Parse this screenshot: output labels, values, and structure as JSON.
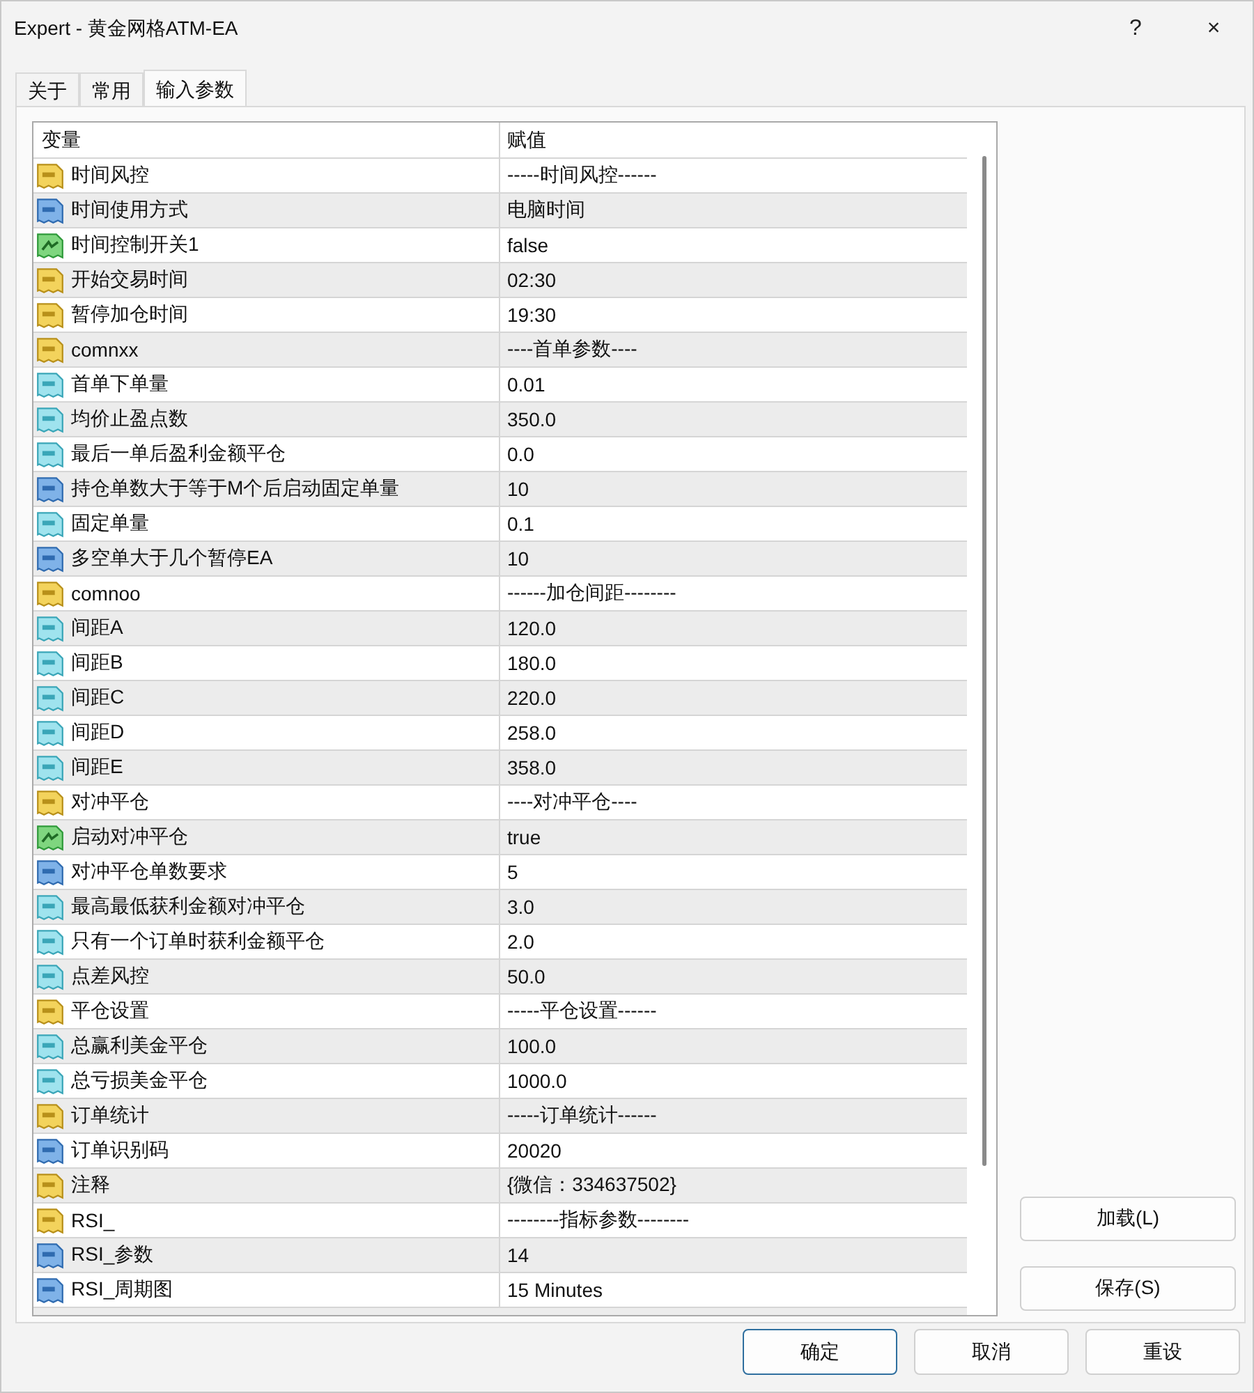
{
  "window": {
    "title": "Expert - 黄金网格ATM-EA",
    "help": "?",
    "close": "×"
  },
  "tabs": [
    {
      "label": "关于",
      "selected": false
    },
    {
      "label": "常用",
      "selected": false
    },
    {
      "label": "输入参数",
      "selected": true
    }
  ],
  "table": {
    "columns": [
      "变量",
      "赋值"
    ],
    "rows": [
      {
        "kind": "string",
        "name": "时间风控",
        "value": "-----时间风控------"
      },
      {
        "kind": "int",
        "name": "时间使用方式",
        "value": "电脑时间"
      },
      {
        "kind": "bool",
        "name": "时间控制开关1",
        "value": "false"
      },
      {
        "kind": "string",
        "name": "开始交易时间",
        "value": "02:30"
      },
      {
        "kind": "string",
        "name": "暂停加仓时间",
        "value": "19:30"
      },
      {
        "kind": "string",
        "name": "comnxx",
        "value": "----首单参数----"
      },
      {
        "kind": "double",
        "name": "首单下单量",
        "value": "0.01"
      },
      {
        "kind": "double",
        "name": "均价止盈点数",
        "value": "350.0"
      },
      {
        "kind": "double",
        "name": "最后一单后盈利金额平仓",
        "value": "0.0"
      },
      {
        "kind": "int",
        "name": "持仓单数大于等于M个后启动固定单量",
        "value": "10"
      },
      {
        "kind": "double",
        "name": "固定单量",
        "value": "0.1"
      },
      {
        "kind": "int",
        "name": "多空单大于几个暂停EA",
        "value": "10"
      },
      {
        "kind": "string",
        "name": "comnoo",
        "value": "------加仓间距--------"
      },
      {
        "kind": "double",
        "name": "间距A",
        "value": "120.0"
      },
      {
        "kind": "double",
        "name": "间距B",
        "value": "180.0"
      },
      {
        "kind": "double",
        "name": "间距C",
        "value": "220.0"
      },
      {
        "kind": "double",
        "name": "间距D",
        "value": "258.0"
      },
      {
        "kind": "double",
        "name": "间距E",
        "value": "358.0"
      },
      {
        "kind": "string",
        "name": "对冲平仓",
        "value": "----对冲平仓----"
      },
      {
        "kind": "bool",
        "name": "启动对冲平仓",
        "value": "true"
      },
      {
        "kind": "int",
        "name": "对冲平仓单数要求",
        "value": "5"
      },
      {
        "kind": "double",
        "name": "最高最低获利金额对冲平仓",
        "value": "3.0"
      },
      {
        "kind": "double",
        "name": "只有一个订单时获利金额平仓",
        "value": "2.0"
      },
      {
        "kind": "double",
        "name": "点差风控",
        "value": "50.0"
      },
      {
        "kind": "string",
        "name": "平仓设置",
        "value": "-----平仓设置------"
      },
      {
        "kind": "double",
        "name": "总赢利美金平仓",
        "value": "100.0"
      },
      {
        "kind": "double",
        "name": "总亏损美金平仓",
        "value": "1000.0"
      },
      {
        "kind": "string",
        "name": "订单统计",
        "value": "-----订单统计------"
      },
      {
        "kind": "int",
        "name": "订单识别码",
        "value": "20020"
      },
      {
        "kind": "string",
        "name": "注释",
        "value": "{微信：334637502}"
      },
      {
        "kind": "string",
        "name": "RSI_",
        "value": "--------指标参数--------"
      },
      {
        "kind": "int",
        "name": "RSI_参数",
        "value": "14"
      },
      {
        "kind": "int",
        "name": "RSI_周期图",
        "value": "15 Minutes"
      }
    ]
  },
  "side_buttons": [
    "加载(L)",
    "保存(S)"
  ],
  "buttons": [
    {
      "label": "确定",
      "default": true
    },
    {
      "label": "取消",
      "default": false
    },
    {
      "label": "重设",
      "default": false
    }
  ]
}
